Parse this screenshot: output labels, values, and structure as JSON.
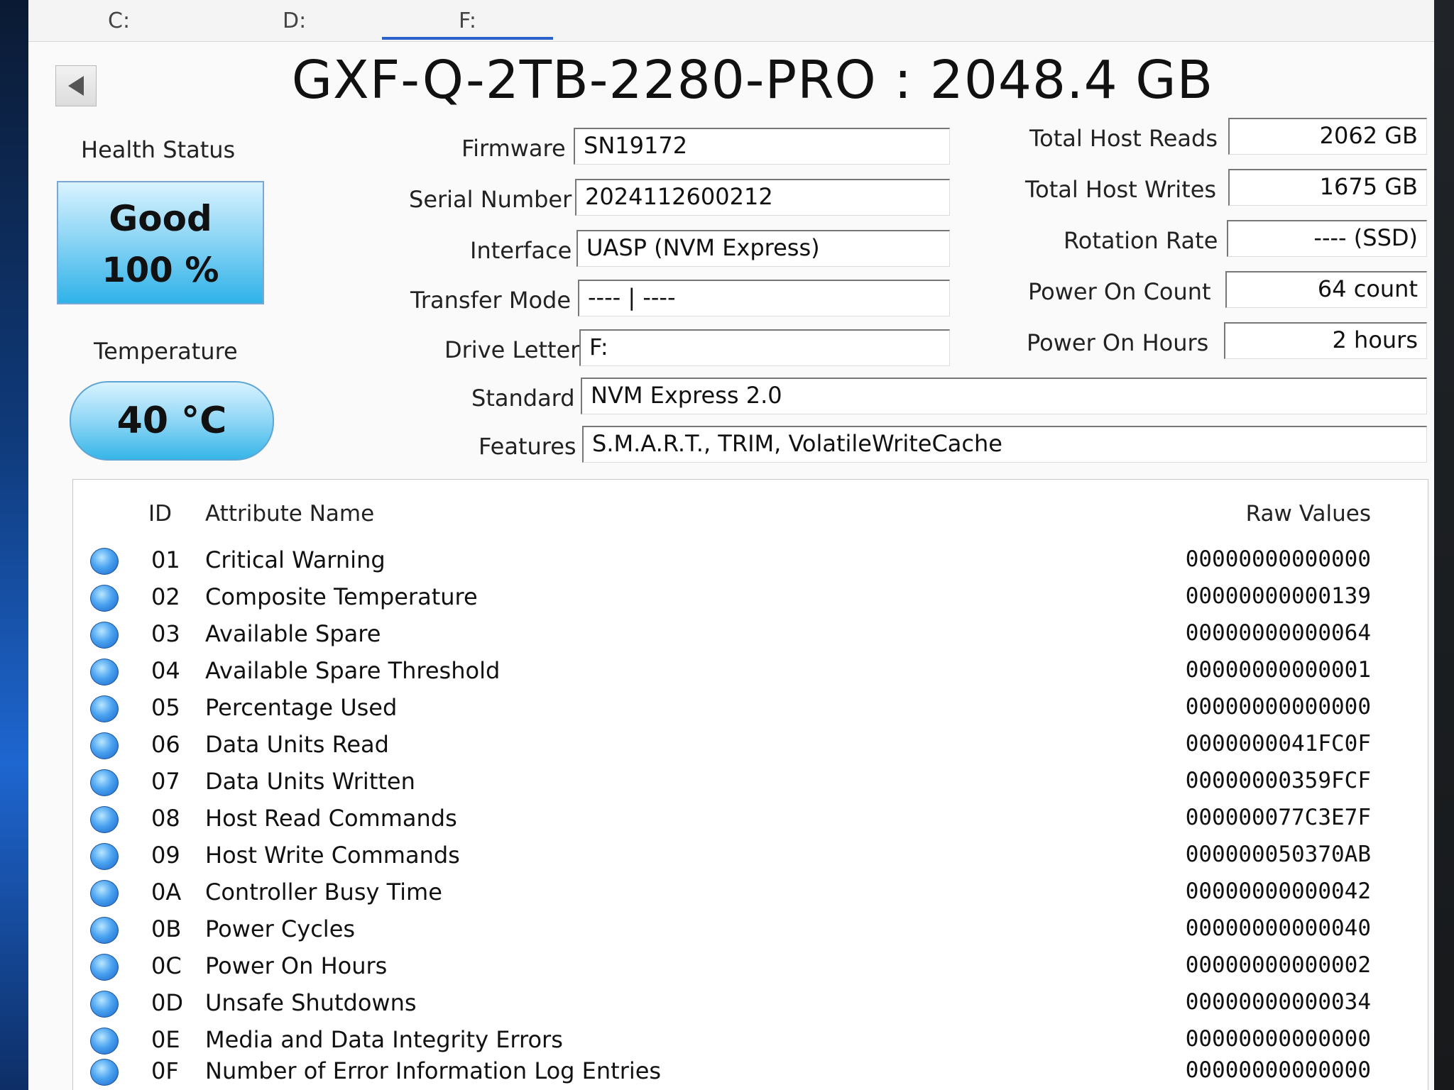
{
  "tabs": [
    {
      "label": "C:"
    },
    {
      "label": "D:"
    },
    {
      "label": "F:"
    }
  ],
  "title": "GXF-Q-2TB-2280-PRO : 2048.4 GB",
  "health": {
    "label": "Health Status",
    "status": "Good",
    "percent": "100 %"
  },
  "temperature": {
    "label": "Temperature",
    "value": "40 °C"
  },
  "info": {
    "firmware": {
      "label": "Firmware",
      "value": "SN19172"
    },
    "serial": {
      "label": "Serial Number",
      "value": "2024112600212"
    },
    "interface": {
      "label": "Interface",
      "value": "UASP (NVM Express)"
    },
    "transfer_mode": {
      "label": "Transfer Mode",
      "value": "---- | ----"
    },
    "drive_letter": {
      "label": "Drive Letter",
      "value": "F:"
    },
    "standard": {
      "label": "Standard",
      "value": "NVM Express 2.0"
    },
    "features": {
      "label": "Features",
      "value": "S.M.A.R.T., TRIM, VolatileWriteCache"
    }
  },
  "stats": {
    "total_host_reads": {
      "label": "Total Host Reads",
      "value": "2062 GB"
    },
    "total_host_writes": {
      "label": "Total Host Writes",
      "value": "1675 GB"
    },
    "rotation_rate": {
      "label": "Rotation Rate",
      "value": "---- (SSD)"
    },
    "power_on_count": {
      "label": "Power On Count",
      "value": "64 count"
    },
    "power_on_hours": {
      "label": "Power On Hours",
      "value": "2 hours"
    }
  },
  "smart": {
    "headers": {
      "id": "ID",
      "name": "Attribute Name",
      "raw": "Raw Values"
    },
    "rows": [
      {
        "id": "01",
        "name": "Critical Warning",
        "raw": "00000000000000"
      },
      {
        "id": "02",
        "name": "Composite Temperature",
        "raw": "00000000000139"
      },
      {
        "id": "03",
        "name": "Available Spare",
        "raw": "00000000000064"
      },
      {
        "id": "04",
        "name": "Available Spare Threshold",
        "raw": "00000000000001"
      },
      {
        "id": "05",
        "name": "Percentage Used",
        "raw": "00000000000000"
      },
      {
        "id": "06",
        "name": "Data Units Read",
        "raw": "0000000041FC0F"
      },
      {
        "id": "07",
        "name": "Data Units Written",
        "raw": "00000000359FCF"
      },
      {
        "id": "08",
        "name": "Host Read Commands",
        "raw": "000000077C3E7F"
      },
      {
        "id": "09",
        "name": "Host Write Commands",
        "raw": "000000050370AB"
      },
      {
        "id": "0A",
        "name": "Controller Busy Time",
        "raw": "00000000000042"
      },
      {
        "id": "0B",
        "name": "Power Cycles",
        "raw": "00000000000040"
      },
      {
        "id": "0C",
        "name": "Power On Hours",
        "raw": "00000000000002"
      },
      {
        "id": "0D",
        "name": "Unsafe Shutdowns",
        "raw": "00000000000034"
      },
      {
        "id": "0E",
        "name": "Media and Data Integrity Errors",
        "raw": "00000000000000"
      },
      {
        "id": "0F",
        "name": "Number of Error Information Log Entries",
        "raw": "00000000000000"
      }
    ]
  }
}
